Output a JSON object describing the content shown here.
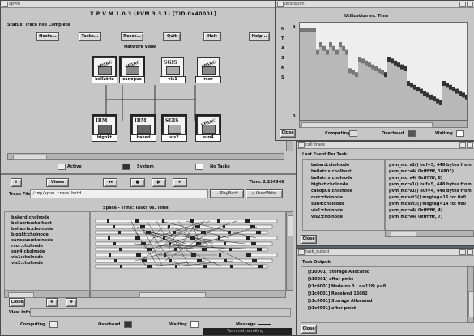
{
  "xpvm": {
    "window_title": "xpvm",
    "title": "X P V M  1.0.3  (PVM 3.3.1)  [TID 0x40001]",
    "status_label": "Status:",
    "status_value": "Trace File Complete",
    "buttons": {
      "hosts": "Hosts...",
      "tasks": "Tasks...",
      "reset": "Reset...",
      "quit": "Quit",
      "halt": "Halt",
      "help": "Help..."
    },
    "network_view_label": "Network View",
    "hosts_top": [
      "bellatrix",
      "canopus",
      "vis1",
      "rsor"
    ],
    "hosts_bottom": [
      "bigbkt",
      "baked",
      "vis2",
      "sun4"
    ],
    "legend": {
      "active": "Active",
      "system": "System",
      "no_tasks": "No Tasks"
    },
    "views_button": "Views",
    "time_label": "Time: 2.234948",
    "trace_file_label": "Trace File:",
    "trace_file_value": "/tmp/xpvm.trace.hutd",
    "playback_label": "PlayBack",
    "overwrite_label": "OverWrite",
    "spacetime_title": "Space - Time: Tasks vs. Time",
    "task_names": [
      "bakerd:cholnode",
      "bellatrix:cholhost",
      "bellatrix:cholnode",
      "bigbkt:cholnode",
      "canopus:cholnode",
      "rsor:cholnode",
      "sun4:cholnode",
      "vis1:cholnode",
      "vis2:cholnode"
    ],
    "view_info_label": "View Info:",
    "bottom_legend": {
      "computing": "Computing",
      "overhead": "Overhead",
      "waiting": "Waiting",
      "message": "Message"
    }
  },
  "utilization": {
    "window_title": "utilization",
    "chart_title": "Utilization vs. Time",
    "y_axis_letters": [
      "N",
      "T",
      "A",
      "S",
      "K",
      "S"
    ],
    "y_ticks": [
      "9",
      "0"
    ],
    "close": "Close",
    "legend": {
      "computing": "Computing",
      "overhead": "Overhead",
      "waiting": "Waiting"
    }
  },
  "call_trace": {
    "window_title": "call_trace",
    "header": "Last Event Per Task:",
    "tasks": [
      "bakerd:cholnode",
      "bellatrix:cholhost",
      "bellatrix:cholnode",
      "bigbkt:cholnode",
      "canopus:cholnode",
      "rsor:cholnode",
      "sun4:cholnode",
      "vis1:cholnode",
      "vis2:cholnode"
    ],
    "events": [
      "pvm_mcrv1() buf=5, 448 bytes from",
      "pvm_mcrv4( 0xfffffff, 16803)",
      "pvm_mcrv4( 0xfffffff, 8)",
      "pvm_mcrv1() buf=5, 448 bytes from",
      "pvm_mcrv1() buf=4, 448 bytes from",
      "pvm_mcast3() msgtag=16 to: 0x0",
      "pvm_mcast3() msgtag=14 to: 0x0",
      "pvm_mcrv4( 0xfffffff, 4)",
      "pvm_mcrv4( 0xfffffff, 7)"
    ],
    "close": "Close"
  },
  "task_output": {
    "window_title": "task_output",
    "header": "Task Output:",
    "lines": [
      "[t10001] Storage Allocated",
      "[t10001] after pmkt",
      "[t1c0001] Node no 3 : n=128; p=8",
      "[t1c0001] Received 16082",
      "[t1c0001] Storage Allocated",
      "[t1c0001] after pmkt"
    ],
    "close": "Close"
  },
  "footer_text": "Terminal: scrolling"
}
